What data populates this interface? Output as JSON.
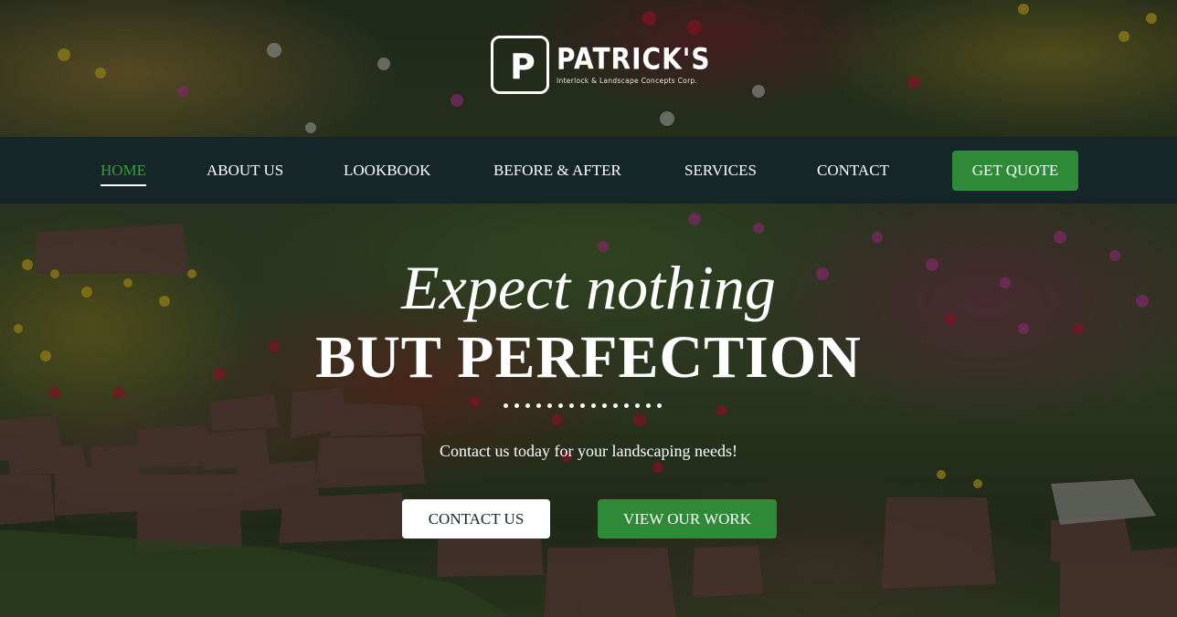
{
  "brand": {
    "logo_letter": "P",
    "name": "PATRICK'S",
    "tagline": "Interlock & Landscape Concepts Corp."
  },
  "nav": {
    "items": [
      {
        "label": "HOME",
        "active": true
      },
      {
        "label": "ABOUT US",
        "active": false
      },
      {
        "label": "LOOKBOOK",
        "active": false
      },
      {
        "label": "BEFORE & AFTER",
        "active": false
      },
      {
        "label": "SERVICES",
        "active": false
      },
      {
        "label": "CONTACT",
        "active": false
      }
    ],
    "cta_label": "GET QUOTE"
  },
  "hero": {
    "script_line": "Expect nothing",
    "title": "BUT PERFECTION",
    "subtitle": "Contact us today for your landscaping needs!",
    "primary_button": "CONTACT US",
    "secondary_button": "VIEW OUR WORK"
  },
  "colors": {
    "nav_bg": "#142627",
    "accent_green": "#2e8a36",
    "active_link": "#3d9b3d",
    "text_white": "#ffffff"
  }
}
